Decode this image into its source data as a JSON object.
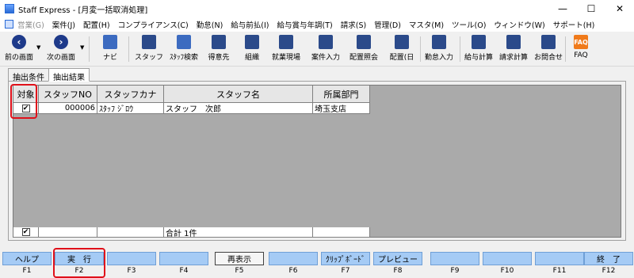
{
  "window": {
    "title": "Staff Express - [月変一括取消処理]",
    "min_glyph": "—",
    "max_glyph": "☐",
    "close_glyph": "✕"
  },
  "menu": [
    {
      "label": "営業(G)",
      "disabled": true
    },
    {
      "label": "案件(J)"
    },
    {
      "label": "配置(H)"
    },
    {
      "label": "コンプライアンス(C)"
    },
    {
      "label": "勤怠(N)"
    },
    {
      "label": "給与前払(I)"
    },
    {
      "label": "給与賞与年調(T)"
    },
    {
      "label": "請求(S)"
    },
    {
      "label": "管理(D)"
    },
    {
      "label": "マスタ(M)"
    },
    {
      "label": "ツール(O)"
    },
    {
      "label": "ウィンドウ(W)"
    },
    {
      "label": "サポート(H)"
    }
  ],
  "toolbar": {
    "prev": "前の画面",
    "next": "次の画面",
    "navi": "ナビ",
    "staff": "スタッフ",
    "staff_search": "ｽﾀｯﾌ検索",
    "client": "得意先",
    "org": "組織",
    "site": "就業現場",
    "case_input": "案件入力",
    "assign_inquiry": "配置照会",
    "assign_day": "配置(日",
    "attendance_input": "勤怠入力",
    "salary_calc": "給与計算",
    "billing_calc": "請求計算",
    "contact": "お問合せ",
    "faq": "FAQ",
    "faq_icon_text": "FAQ"
  },
  "tabs": {
    "conditions": "抽出条件",
    "results": "抽出結果"
  },
  "grid": {
    "headers": [
      "対象",
      "スタッフNO",
      "スタッフカナ",
      "スタッフ名",
      "所属部門"
    ],
    "rows": [
      {
        "checked": true,
        "check_glyph": "✔",
        "staff_no": "000006",
        "kana": "ｽﾀｯﾌ ｼﾞﾛｳ",
        "name": "スタッフ　次郎",
        "dept": "埼玉支店"
      }
    ],
    "footer": {
      "check_glyph": "✔",
      "total": "合計 1件"
    }
  },
  "fkeys": [
    {
      "face": "ヘルプ",
      "key": "F1"
    },
    {
      "face": "実　行",
      "key": "F2"
    },
    {
      "face": "",
      "key": "F3"
    },
    {
      "face": "",
      "key": "F4"
    },
    {
      "face": "再表示",
      "key": "F5"
    },
    {
      "face": "",
      "key": "F6"
    },
    {
      "face": "ｸﾘｯﾌﾟﾎﾞｰﾄﾞ",
      "key": "F7"
    },
    {
      "face": "プレビュー",
      "key": "F8"
    },
    {
      "face": "",
      "key": "F9"
    },
    {
      "face": "",
      "key": "F10"
    },
    {
      "face": "",
      "key": "F11"
    },
    {
      "face": "終　了",
      "key": "F12"
    }
  ],
  "colors": {
    "fkey_face": "#a5cbf5",
    "highlight": "#e0101a",
    "grid_bg": "#aaaaaa"
  }
}
